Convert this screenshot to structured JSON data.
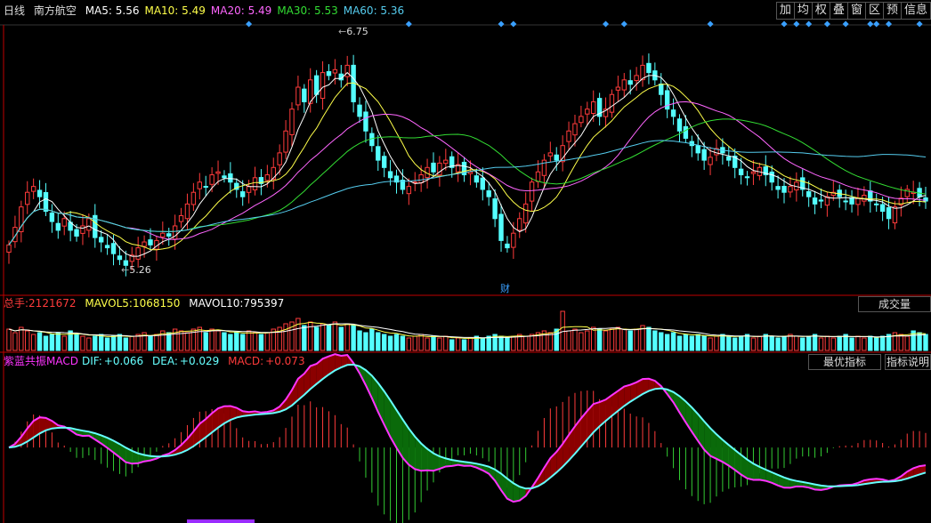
{
  "header": {
    "period": "日线",
    "stock_name": "南方航空",
    "ma": [
      {
        "label": "MA5:",
        "value": "5.56",
        "color": "#ffffff"
      },
      {
        "label": "MA10:",
        "value": "5.49",
        "color": "#ffff4a"
      },
      {
        "label": "MA20:",
        "value": "5.49",
        "color": "#ff66ff"
      },
      {
        "label": "MA30:",
        "value": "5.53",
        "color": "#33dd33"
      },
      {
        "label": "MA60:",
        "value": "5.36",
        "color": "#55ccee"
      }
    ]
  },
  "toolbar": [
    "加",
    "均",
    "权",
    "叠",
    "窗",
    "区",
    "预",
    "信息"
  ],
  "price_panel": {
    "high_label": "6.75",
    "low_label": "5.26",
    "event_marker": "财"
  },
  "volume_panel": {
    "total_label": "总手:",
    "total_value": "2121672",
    "mavol5_label": "MAVOL5:",
    "mavol5_value": "1068150",
    "mavol10_label": "MAVOL10:",
    "mavol10_value": "795397",
    "button": "成交量"
  },
  "macd_panel": {
    "name": "紫蓝共振MACD",
    "dif_label": "DIF:",
    "dif_value": "+0.066",
    "dea_label": "DEA:",
    "dea_value": "+0.029",
    "macd_label": "MACD:",
    "macd_value": "+0.073",
    "buttons": [
      "最优指标",
      "指标说明"
    ]
  },
  "colors": {
    "up": "#ff3b3b",
    "down": "#54ffff",
    "ma5": "#ffffff",
    "ma10": "#ffff4a",
    "ma20": "#ff66ff",
    "ma30": "#33dd33",
    "ma60": "#55ccee",
    "dif": "#ff33ff",
    "dea": "#66ffff",
    "panel_border": "#c00000",
    "diamond": "#3aa0ff"
  },
  "chart_data": {
    "type": "candlestick",
    "price_range": [
      5.16,
      6.89
    ],
    "closes": [
      5.42,
      5.54,
      5.68,
      5.78,
      5.82,
      5.75,
      5.65,
      5.58,
      5.52,
      5.6,
      5.52,
      5.48,
      5.55,
      5.6,
      5.47,
      5.44,
      5.4,
      5.36,
      5.32,
      5.28,
      5.35,
      5.4,
      5.44,
      5.42,
      5.45,
      5.5,
      5.48,
      5.55,
      5.62,
      5.7,
      5.78,
      5.85,
      5.82,
      5.9,
      5.92,
      5.88,
      5.85,
      5.8,
      5.75,
      5.82,
      5.88,
      5.84,
      5.9,
      5.95,
      6.05,
      6.2,
      6.35,
      6.5,
      6.4,
      6.55,
      6.45,
      6.6,
      6.58,
      6.62,
      6.55,
      6.65,
      6.4,
      6.3,
      6.2,
      6.1,
      6.0,
      5.95,
      5.88,
      5.85,
      5.8,
      5.82,
      5.85,
      5.9,
      5.95,
      5.92,
      5.98,
      6.0,
      5.95,
      5.97,
      5.9,
      5.92,
      5.85,
      5.8,
      5.75,
      5.6,
      5.45,
      5.4,
      5.5,
      5.6,
      5.7,
      5.85,
      5.92,
      6.0,
      6.05,
      6.0,
      6.1,
      6.2,
      6.25,
      6.3,
      6.35,
      6.4,
      6.3,
      6.35,
      6.45,
      6.5,
      6.55,
      6.52,
      6.58,
      6.65,
      6.6,
      6.55,
      6.45,
      6.35,
      6.3,
      6.2,
      6.15,
      6.1,
      6.05,
      6.0,
      6.02,
      6.08,
      6.05,
      6.0,
      5.95,
      5.9,
      5.88,
      5.92,
      5.95,
      5.9,
      5.85,
      5.8,
      5.78,
      5.82,
      5.85,
      5.8,
      5.75,
      5.7,
      5.72,
      5.75,
      5.78,
      5.75,
      5.72,
      5.7,
      5.74,
      5.76,
      5.72,
      5.7,
      5.65,
      5.6,
      5.68,
      5.74,
      5.8,
      5.78,
      5.75,
      5.72
    ],
    "volumes": [
      1.2,
      1.0,
      1.3,
      1.1,
      0.9,
      1.0,
      0.8,
      0.9,
      1.0,
      0.8,
      1.1,
      0.9,
      0.8,
      0.7,
      0.8,
      0.9,
      0.7,
      0.8,
      0.9,
      0.7,
      0.8,
      0.9,
      1.0,
      0.8,
      0.9,
      1.1,
      1.0,
      1.2,
      1.1,
      1.0,
      1.2,
      1.3,
      1.0,
      1.2,
      1.1,
      1.0,
      0.9,
      1.0,
      0.9,
      1.1,
      1.0,
      0.9,
      1.0,
      1.2,
      1.3,
      1.5,
      1.6,
      1.8,
      1.4,
      1.6,
      1.3,
      1.5,
      1.4,
      1.6,
      1.3,
      1.5,
      1.4,
      1.1,
      1.0,
      1.2,
      1.0,
      0.9,
      0.8,
      0.9,
      0.8,
      0.7,
      0.8,
      0.9,
      0.7,
      0.8,
      0.7,
      0.8,
      0.6,
      0.7,
      0.6,
      0.7,
      0.8,
      0.7,
      0.8,
      0.9,
      0.8,
      0.7,
      0.8,
      0.9,
      0.8,
      0.9,
      1.0,
      1.1,
      1.0,
      1.2,
      2.2,
      1.1,
      1.2,
      1.0,
      1.1,
      1.3,
      1.2,
      1.1,
      1.2,
      1.3,
      1.2,
      1.1,
      1.2,
      1.4,
      1.3,
      1.1,
      1.0,
      0.9,
      1.0,
      0.8,
      0.9,
      0.8,
      0.9,
      0.8,
      0.7,
      0.8,
      0.9,
      0.8,
      0.7,
      0.8,
      0.9,
      0.7,
      0.8,
      0.9,
      0.8,
      0.7,
      0.8,
      0.9,
      0.8,
      0.7,
      0.8,
      0.9,
      0.7,
      0.8,
      0.7,
      0.8,
      0.9,
      0.7,
      0.8,
      0.7,
      0.8,
      0.7,
      0.8,
      0.9,
      1.0,
      0.9,
      0.8,
      1.1,
      1.0,
      0.9
    ],
    "macd_range": [
      -0.19,
      0.2
    ],
    "diamond_positions": [
      39,
      65,
      80,
      82,
      97,
      100,
      114,
      126,
      128,
      130,
      133,
      136,
      140,
      141,
      143,
      148
    ]
  }
}
